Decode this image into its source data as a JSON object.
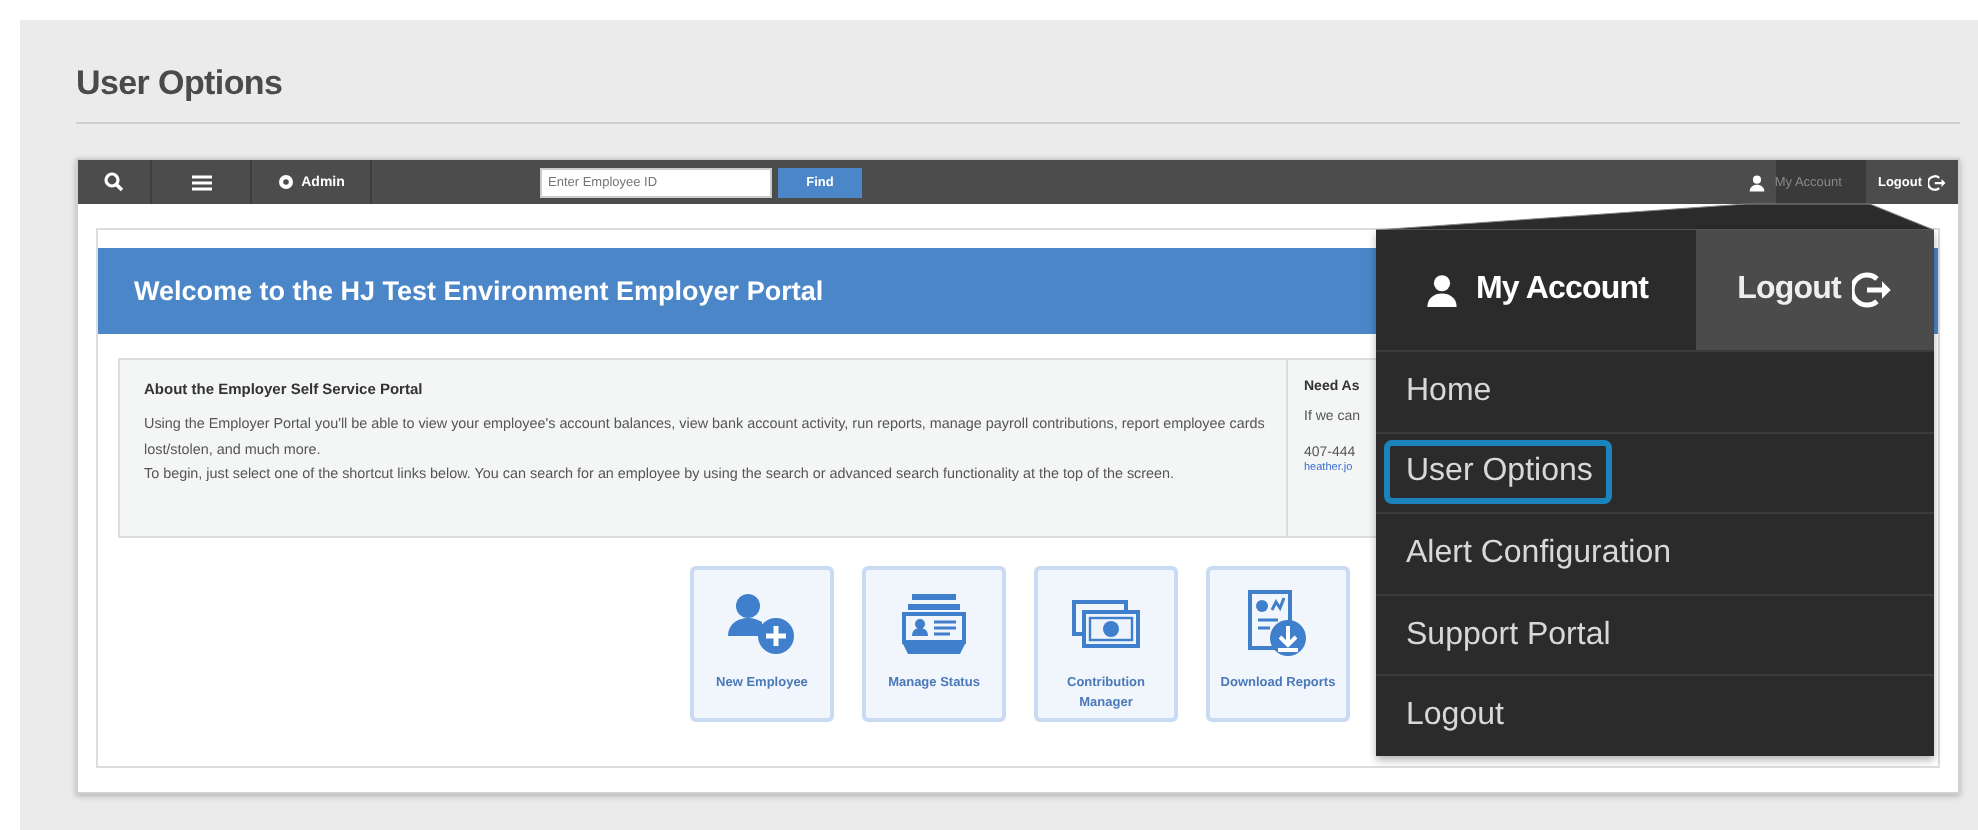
{
  "page_title": "User Options",
  "toolbar": {
    "admin_label": "Admin",
    "search": {
      "placeholder": "Enter Employee ID"
    },
    "find_button": "Find",
    "account_label": "My Account",
    "logout_label": "Logout"
  },
  "banner": "Welcome to the HJ Test Environment Employer Portal",
  "about": {
    "heading": "About the Employer Self Service Portal",
    "paragraphs": [
      "Using the Employer Portal you'll be able to view your employee's account balances, view bank account activity, run reports, manage payroll contributions, report employee cards lost/stolen, and much more.",
      "To begin, just select one of the shortcut links below. You can search for an employee by using the search or advanced search functionality at the top of the screen."
    ]
  },
  "help": {
    "heading": "Need As",
    "line": "If we can",
    "phone": "407-444",
    "email": "heather.jo"
  },
  "shortcuts": [
    {
      "label": "New Employee",
      "kind": "person-add"
    },
    {
      "label": "Manage Status",
      "kind": "id-card"
    },
    {
      "label": "Contribution Manager",
      "kind": "money"
    },
    {
      "label": "Download Reports",
      "kind": "report-download"
    }
  ],
  "account_menu": {
    "header": "My Account",
    "logout": "Logout",
    "items": [
      {
        "label": "Home",
        "selected": false
      },
      {
        "label": "User Options",
        "selected": true
      },
      {
        "label": "Alert Configuration",
        "selected": false
      },
      {
        "label": "Support Portal",
        "selected": false
      },
      {
        "label": "Logout",
        "selected": false
      }
    ]
  }
}
